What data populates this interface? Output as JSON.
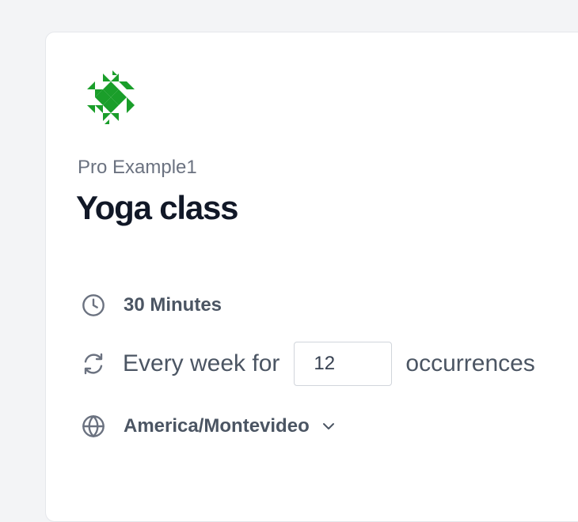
{
  "profile": {
    "name": "Pro Example1",
    "logo_icon": "pinwheel-logo-icon",
    "brand_color": "#1a9e2a"
  },
  "event": {
    "title": "Yoga class"
  },
  "details": {
    "duration": {
      "icon": "clock-icon",
      "label": "30 Minutes"
    },
    "recurrence": {
      "icon": "refresh-icon",
      "prefix": "Every week for",
      "occurrences_value": "12",
      "suffix": "occurrences"
    },
    "timezone": {
      "icon": "globe-icon",
      "selected": "America/Montevideo",
      "dropdown_icon": "chevron-down-icon"
    }
  }
}
